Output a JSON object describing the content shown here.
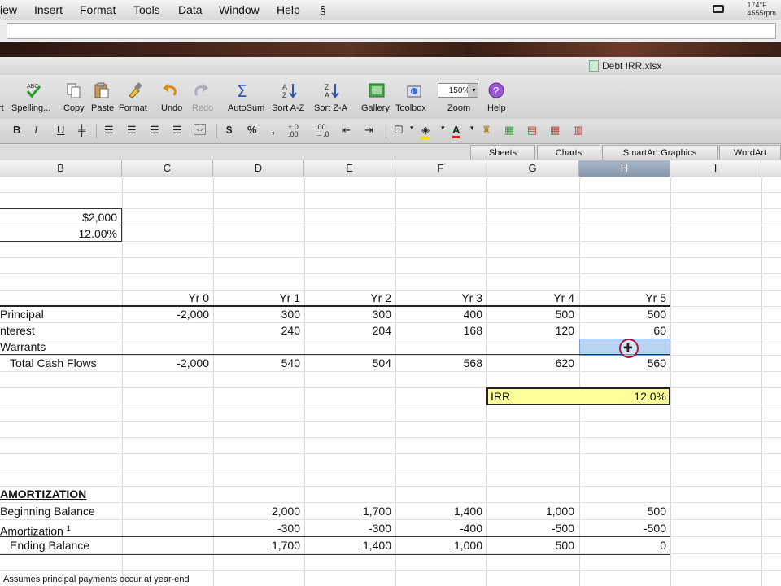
{
  "menubar": {
    "items": [
      "iew",
      "Insert",
      "Format",
      "Tools",
      "Data",
      "Window",
      "Help"
    ],
    "script_icon": "script-icon",
    "temp": "174°F",
    "rpm": "4555rpm"
  },
  "window": {
    "title": "Debt IRR.xlsx"
  },
  "toolbar": {
    "buttons": [
      {
        "label": "rt",
        "icon": "insert-icon"
      },
      {
        "label": "Spelling...",
        "icon": "spelling-icon"
      },
      {
        "label": "Copy",
        "icon": "copy-icon"
      },
      {
        "label": "Paste",
        "icon": "paste-icon"
      },
      {
        "label": "Format",
        "icon": "format-painter-icon"
      },
      {
        "label": "Undo",
        "icon": "undo-icon"
      },
      {
        "label": "Redo",
        "icon": "redo-icon"
      },
      {
        "label": "AutoSum",
        "icon": "sigma-icon"
      },
      {
        "label": "Sort A-Z",
        "icon": "sort-az-icon"
      },
      {
        "label": "Sort Z-A",
        "icon": "sort-za-icon"
      },
      {
        "label": "Gallery",
        "icon": "gallery-icon"
      },
      {
        "label": "Toolbox",
        "icon": "toolbox-icon"
      },
      {
        "label": "Zoom",
        "icon": "zoom-icon"
      },
      {
        "label": "Help",
        "icon": "help-icon"
      }
    ],
    "zoom_value": "150%"
  },
  "formatbar": {
    "bold": "B",
    "italic": "I",
    "underline": "U",
    "currency": "$",
    "percent": "%",
    "comma": ",",
    "inc_decimal": "+.0 .00",
    "dec_decimal": ".00 →.0",
    "font_color": "A"
  },
  "ribbon": {
    "tabs": [
      "Sheets",
      "Charts",
      "SmartArt Graphics",
      "WordArt"
    ]
  },
  "columns": [
    "B",
    "C",
    "D",
    "E",
    "F",
    "G",
    "H",
    "I"
  ],
  "selected_column": "H",
  "sheet": {
    "inputs": [
      "$2,000",
      "12.00%"
    ],
    "year_headers": [
      "Yr 0",
      "Yr 1",
      "Yr 2",
      "Yr 3",
      "Yr 4",
      "Yr 5"
    ],
    "rows": [
      {
        "label": "Principal",
        "values": [
          "-2,000",
          "300",
          "300",
          "400",
          "500",
          "500"
        ]
      },
      {
        "label": "nterest",
        "values": [
          "",
          "240",
          "204",
          "168",
          "120",
          "60"
        ]
      },
      {
        "label": "Warrants",
        "values": [
          "",
          "",
          "",
          "",
          "",
          ""
        ]
      },
      {
        "label": "Total Cash Flows",
        "values": [
          "-2,000",
          "540",
          "504",
          "568",
          "620",
          "560"
        ]
      }
    ],
    "irr": {
      "label": "IRR",
      "value": "12.0%"
    },
    "amortization": {
      "title": "AMORTIZATION",
      "rows": [
        {
          "label": "Beginning Balance",
          "values": [
            "2,000",
            "1,700",
            "1,400",
            "1,000",
            "500"
          ]
        },
        {
          "label": "Amortization",
          "footnote": "1",
          "values": [
            "-300",
            "-300",
            "-400",
            "-500",
            "-500"
          ]
        },
        {
          "label": "Ending Balance",
          "values": [
            "1,700",
            "1,400",
            "1,000",
            "500",
            "0"
          ]
        }
      ]
    },
    "footnote": "Assumes principal payments occur at year-end"
  }
}
